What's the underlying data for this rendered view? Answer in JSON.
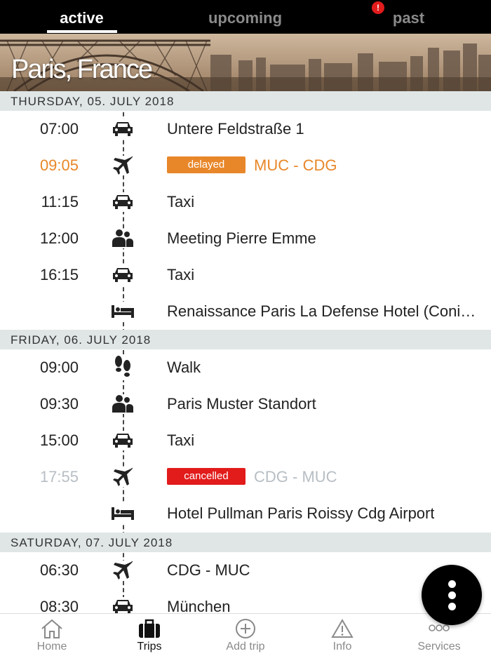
{
  "tabs": [
    {
      "label": "active"
    },
    {
      "label": "upcoming"
    },
    {
      "label": "past"
    }
  ],
  "hero": {
    "title": "Paris, France"
  },
  "days": [
    {
      "label": "THURSDAY, 05. JULY 2018"
    },
    {
      "label": "FRIDAY, 06. JULY 2018"
    },
    {
      "label": "SATURDAY, 07. JULY 2018"
    }
  ],
  "items": [
    {
      "time": "07:00",
      "icon": "car-icon",
      "text": "Untere Feldstraße 1"
    },
    {
      "time": "09:05",
      "icon": "plane-icon",
      "badge": "delayed",
      "text": "MUC - CDG",
      "status_color": "#e8872a"
    },
    {
      "time": "11:15",
      "icon": "car-icon",
      "text": "Taxi"
    },
    {
      "time": "12:00",
      "icon": "meeting-icon",
      "text": "Meeting Pierre Emme"
    },
    {
      "time": "16:15",
      "icon": "car-icon",
      "text": "Taxi"
    },
    {
      "time": "",
      "icon": "hotel-bed-icon",
      "text": "Renaissance Paris La Defense Hotel (Coni…"
    },
    {
      "time": "09:00",
      "icon": "footsteps-icon",
      "text": "Walk"
    },
    {
      "time": "09:30",
      "icon": "meeting-icon",
      "text": "Paris Muster Standort"
    },
    {
      "time": "15:00",
      "icon": "car-icon",
      "text": "Taxi"
    },
    {
      "time": "17:55",
      "icon": "plane-icon",
      "badge": "cancelled",
      "text": "CDG - MUC",
      "status_color": "#e21b1b"
    },
    {
      "time": "",
      "icon": "hotel-bed-icon",
      "text": "Hotel Pullman Paris Roissy Cdg Airport"
    },
    {
      "time": "06:30",
      "icon": "plane-icon",
      "text": "CDG - MUC"
    },
    {
      "time": "08:30",
      "icon": "car-icon",
      "text": "München"
    }
  ],
  "nav": [
    {
      "label": "Home",
      "icon": "home-icon"
    },
    {
      "label": "Trips",
      "icon": "suitcase-icon"
    },
    {
      "label": "Add trip",
      "icon": "add-circle-icon"
    },
    {
      "label": "Info",
      "icon": "warning-icon"
    },
    {
      "label": "Services",
      "icon": "more-dots-icon"
    }
  ],
  "info_badge": "!",
  "colors": {
    "accent": "#e8872a",
    "alert": "#e21b1b",
    "header_bg": "#e0e6e6"
  }
}
